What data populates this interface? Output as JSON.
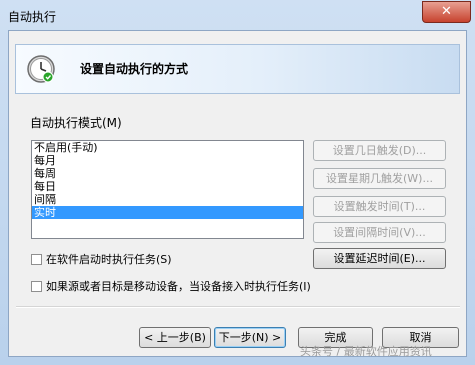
{
  "window": {
    "title": "自动执行",
    "close_glyph": "✕"
  },
  "header": {
    "text": "设置自动执行的方式",
    "icon": "clock-icon"
  },
  "mode": {
    "label": "自动执行模式(M)",
    "options": [
      "不启用(手动)",
      "每月",
      "每周",
      "每日",
      "间隔",
      "实时"
    ],
    "selected": "实时"
  },
  "side_buttons": {
    "monthly_day": "设置几日触发(D)...",
    "weekday": "设置星期几触发(W)...",
    "trigger_time": "设置触发时间(T)...",
    "interval_time": "设置间隔时间(V)...",
    "delay_time": "设置延迟时间(E)..."
  },
  "checkboxes": {
    "on_startup": "在软件启动时执行任务(S)",
    "on_device": "如果源或者目标是移动设备，当设备接入时执行任务(I)"
  },
  "footer": {
    "back": "< 上一步(B)",
    "next": "下一步(N) >",
    "finish": "完成",
    "cancel": "取消"
  },
  "watermark": "头条号 / 最新软件应用资讯"
}
